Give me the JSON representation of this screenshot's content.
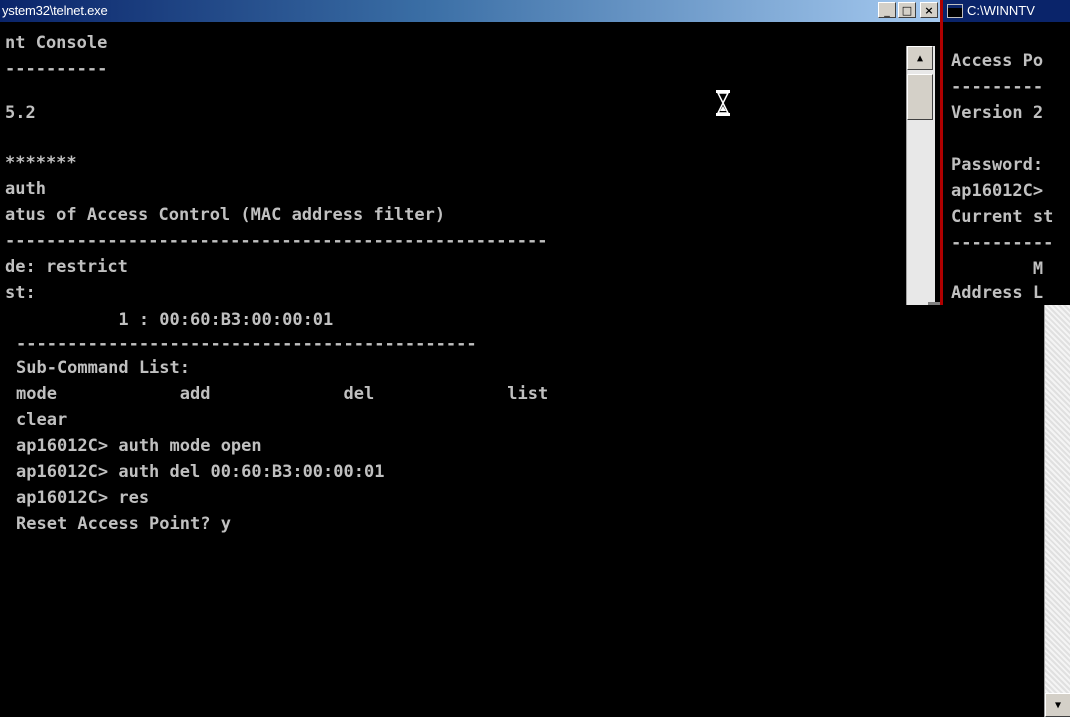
{
  "telnet_window": {
    "title": "ystem32\\telnet.exe",
    "buttons": [
      "_",
      "□",
      "×"
    ],
    "lines": [
      "nt Console",
      "----------",
      "5.2",
      "",
      "*******",
      "auth",
      "atus of Access Control (MAC address filter)",
      "-----------------------------------------------------",
      "de: restrict",
      "st:"
    ]
  },
  "cmd_window": {
    "title": "C:\\WINNTV",
    "lines": [
      "Access Po",
      "---------",
      "Version 2",
      "",
      "Password:",
      "ap16012C>",
      "Current st",
      "----------",
      "        M",
      "Address L"
    ]
  },
  "lower_console": {
    "lines": [
      "          1 : 00:60:B3:00:00:01",
      "---------------------------------------------",
      "Sub-Command List:",
      "mode            add             del             list",
      "clear",
      "ap16012C> auth mode open",
      "ap16012C> auth del 00:60:B3:00:00:01",
      "ap16012C> res",
      "Reset Access Point? y"
    ]
  },
  "colors": {
    "console_bg": "#000000",
    "console_text": "#c0c0c0",
    "titlebar_active": "#0a246a"
  },
  "icons": [
    "hourglass-icon",
    "cmd-icon",
    "scroll-up-icon",
    "scroll-down-icon"
  ]
}
